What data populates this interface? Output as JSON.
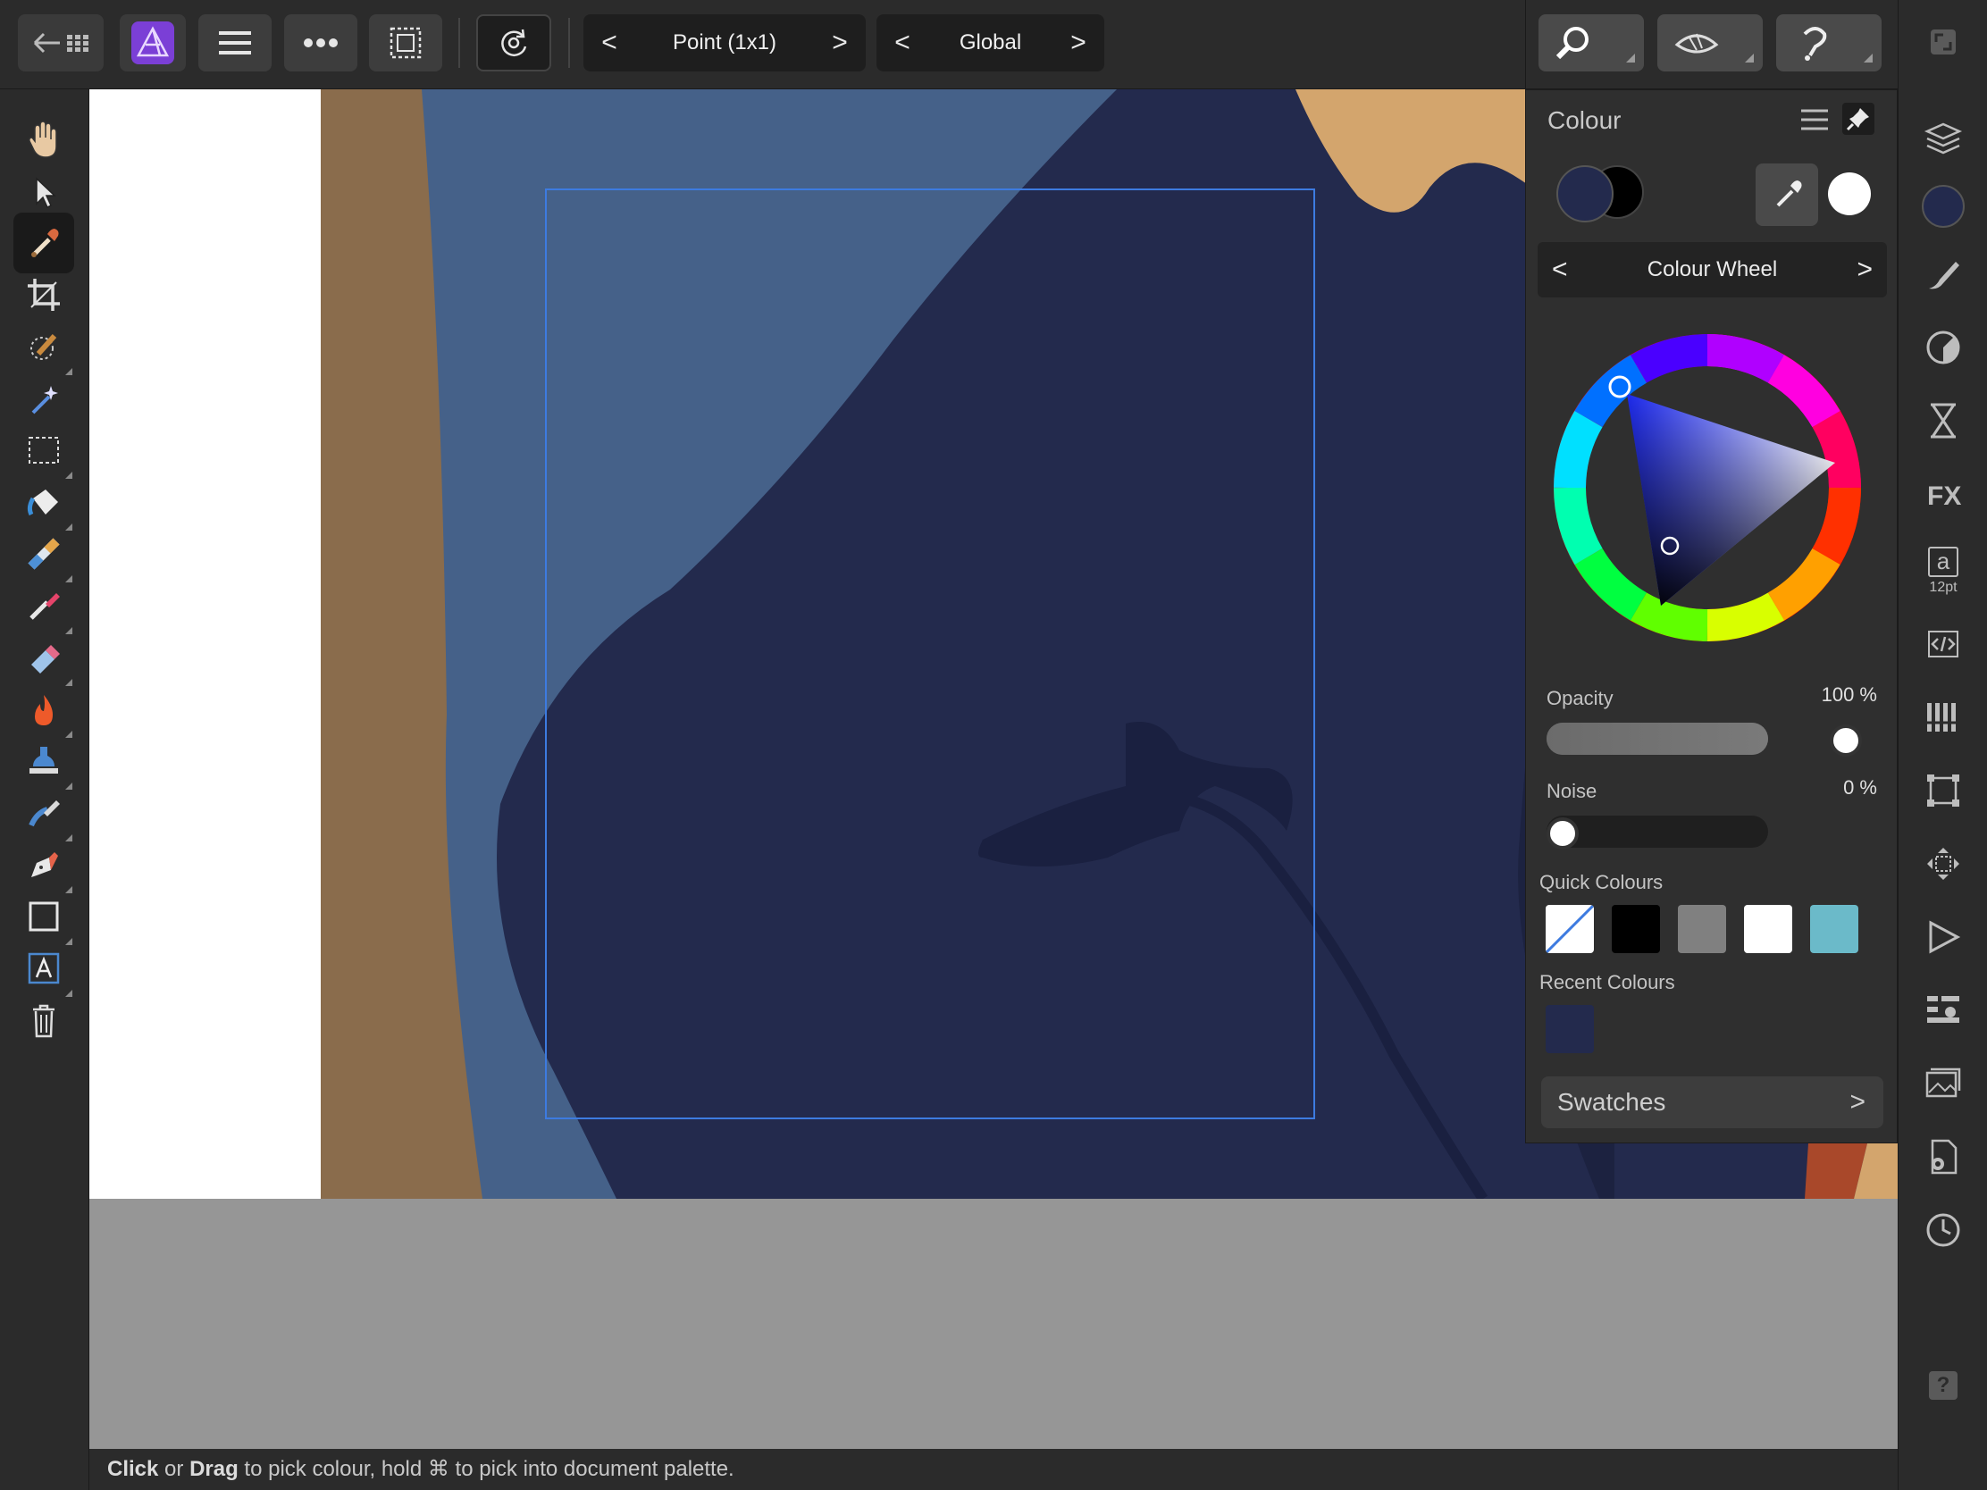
{
  "toolbar": {
    "app_icon": "affinity-photo-logo",
    "sample_nav": {
      "prev": "<",
      "label": "Point (1x1)",
      "next": ">"
    },
    "source_nav": {
      "prev": "<",
      "label": "Global",
      "next": ">"
    }
  },
  "left_tools": [
    "hand-tool",
    "move-tool",
    "colour-picker-tool",
    "crop-tool",
    "selection-brush-tool",
    "flood-select-tool",
    "rectangular-marquee-tool",
    "flood-fill-tool",
    "gradient-tool",
    "paint-brush-tool",
    "erase-brush-tool",
    "dodge-brush-tool",
    "clone-brush-tool",
    "smudge-brush-tool",
    "pen-tool",
    "rectangle-tool",
    "artistic-text-tool",
    "delete-icon"
  ],
  "panel": {
    "title": "Colour",
    "mode_nav": {
      "prev": "<",
      "label": "Colour Wheel",
      "next": ">"
    },
    "opacity": {
      "label": "Opacity",
      "value": "100 %",
      "level": 1.0
    },
    "noise": {
      "label": "Noise",
      "value": "0 %",
      "level": 0.0
    },
    "quick_colours": {
      "label": "Quick Colours",
      "colors": [
        "none",
        "#000000",
        "#808080",
        "#ffffff",
        "#6bbac9"
      ]
    },
    "recent_colours": {
      "label": "Recent Colours",
      "colors": [
        "#232a4d"
      ]
    },
    "swatches": {
      "label": "Swatches",
      "chevron": ">"
    },
    "primary_color": "#232a4d",
    "secondary_color": "#000000"
  },
  "studio_strip": {
    "font_size_label": "12pt",
    "text_icon_letter": "a",
    "help": "?"
  },
  "status": {
    "click": "Click",
    "or": " or ",
    "drag": "Drag",
    "rest": " to pick colour, hold ⌘ to pick into document palette."
  }
}
